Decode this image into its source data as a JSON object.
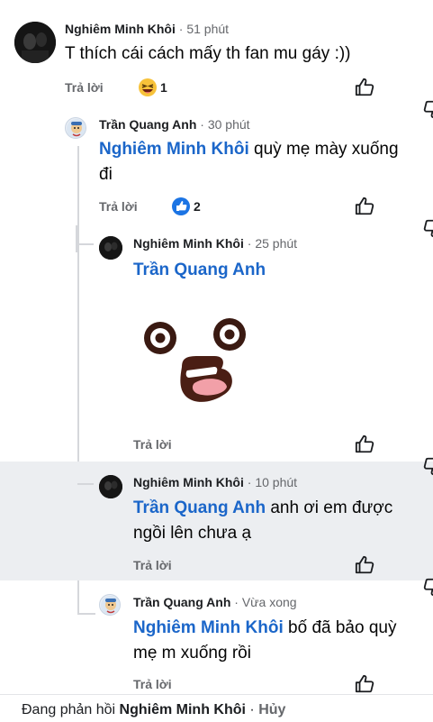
{
  "comments": [
    {
      "author": "Nghiêm Minh Khôi",
      "time": "51 phút",
      "text": "T thích cái cách mấy th fan mu gáy :))",
      "reply": "Trả lời",
      "reaction_count": "1",
      "reaction": "laugh-emoji"
    },
    {
      "author": "Trần Quang Anh",
      "time": "30 phút",
      "tag": "Nghiêm Minh Khôi",
      "text_line1": " quỳ mẹ mày xuống",
      "text_line2": "đi",
      "reply": "Trả lời",
      "reaction_count": "2",
      "reaction": "like"
    },
    {
      "author": "Nghiêm Minh Khôi",
      "time": "25 phút",
      "tag": "Trần Quang Anh",
      "sticker": "surprised-face-sticker",
      "reply": "Trả lời"
    },
    {
      "author": "Nghiêm Minh Khôi",
      "time": "10 phút",
      "tag": "Trần Quang Anh",
      "text_line1": " anh ơi em được",
      "text_line2": "ngồi lên chưa ạ",
      "reply": "Trả lời"
    },
    {
      "author": "Trần Quang Anh",
      "time": "Vừa xong",
      "tag": "Nghiêm Minh Khôi",
      "text_line1": " bố đã bảo quỳ",
      "text_line2": "mẹ m xuống rồi",
      "reply": "Trả lời"
    }
  ],
  "separator": " · ",
  "bottom": {
    "prefix": "Đang phản hồi ",
    "name": "Nghiêm Minh Khôi",
    "sep": " · ",
    "cancel": "Hủy"
  },
  "colors": {
    "mention": "#1b66c9",
    "meta": "#65676b",
    "highlight": "#eceef1"
  }
}
